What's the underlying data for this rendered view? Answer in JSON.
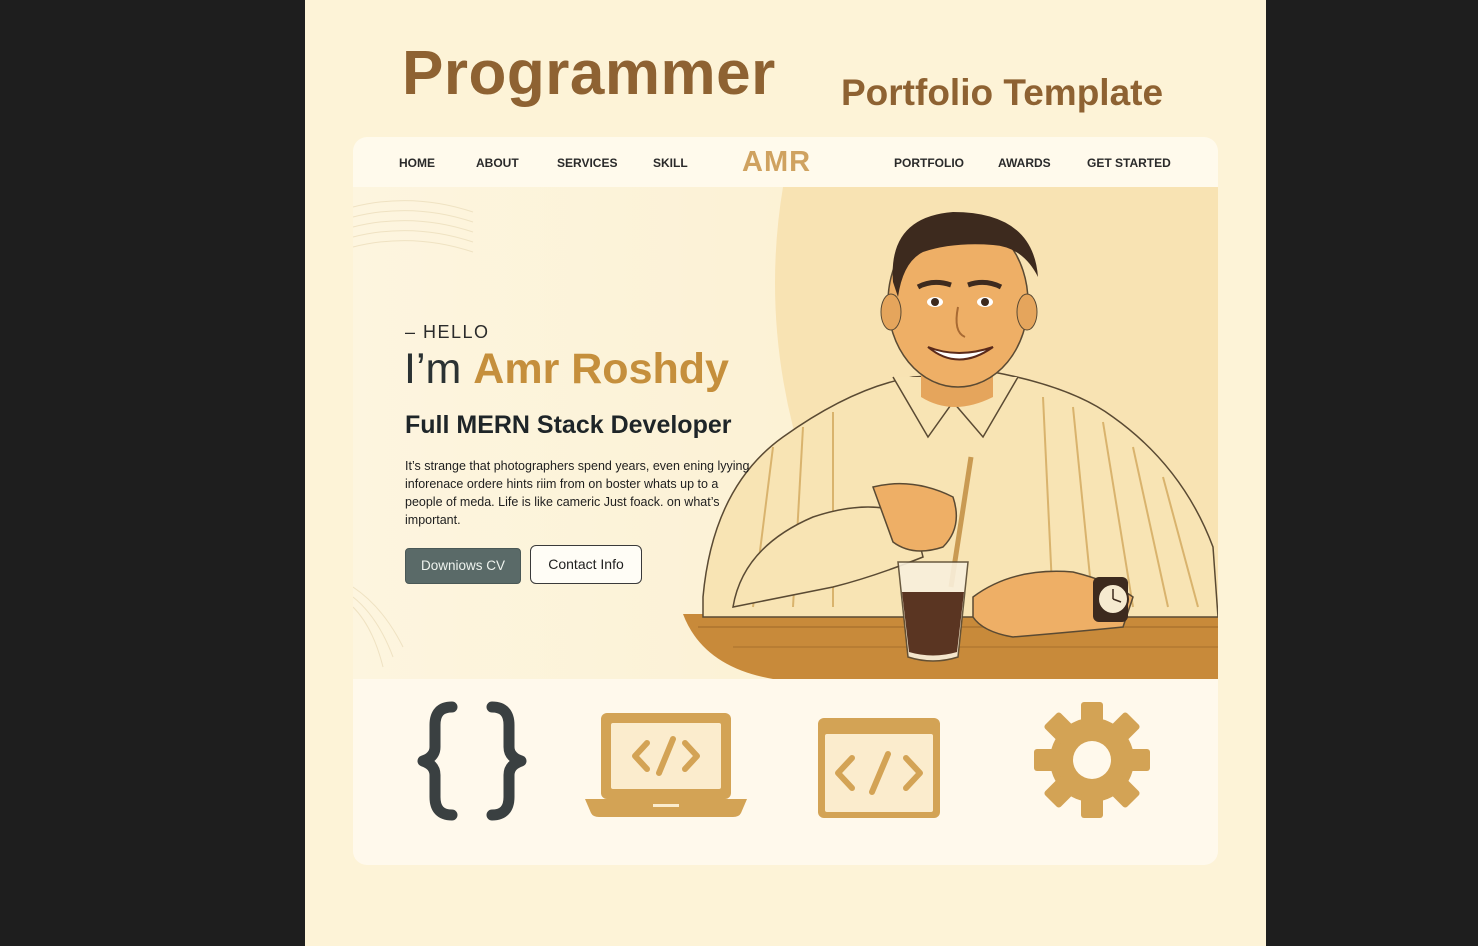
{
  "poster": {
    "title": "Programmer",
    "subtitle": "Portfolio Template"
  },
  "nav": {
    "brand": "AMR",
    "left_items": [
      "HOME",
      "ABOUT",
      "SERVICES",
      "SKILL"
    ],
    "right_items": [
      "PORTFOLIO",
      "AWARDS",
      "GET STARTED"
    ]
  },
  "hero": {
    "greeting": "– HELLO",
    "intro_prefix": "I’m ",
    "name": "Amr Roshdy",
    "role": "Full MERN Stack Developer",
    "bio": "It’s strange that photographers spend years, even ening lyying inforenace ordere hints riim from on boster whats up to a people of meda. Life is like cameric Just foack. on what’s important.",
    "cv_button": "Downiows CV",
    "contact_button": "Contact Info",
    "illustration": "developer-with-drink-illustration"
  },
  "feature_icons": [
    "curly-braces-icon",
    "laptop-code-icon",
    "browser-code-icon",
    "gear-icon"
  ],
  "colors": {
    "background": "#fdf3d7",
    "accent": "#c58f3c",
    "title": "#8e6232",
    "dark_button": "#5a6a68",
    "icon_gold": "#d3a355",
    "icon_dark": "#3a4041"
  }
}
